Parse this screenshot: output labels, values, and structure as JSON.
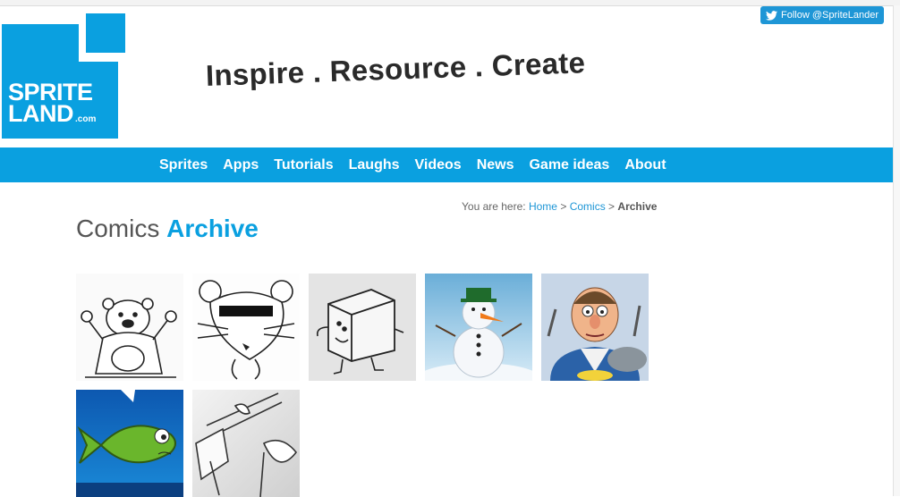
{
  "header": {
    "logo_line1": "SPRITE",
    "logo_line2": "LAND",
    "logo_suffix": ".com",
    "tagline": "Inspire . Resource . Create",
    "follow_button": "Follow @SpriteLander"
  },
  "nav": {
    "items": [
      "Sprites",
      "Apps",
      "Tutorials",
      "Laughs",
      "Videos",
      "News",
      "Game ideas",
      "About"
    ]
  },
  "breadcrumb": {
    "prefix": "You are here:",
    "home": "Home",
    "sep1": ">",
    "comics": "Comics",
    "sep2": ">",
    "current": "Archive"
  },
  "page": {
    "title_part1": "Comics",
    "title_part2": "Archive"
  },
  "comics": [
    {
      "name": "bear-comic"
    },
    {
      "name": "mouse-comic"
    },
    {
      "name": "cube-comic"
    },
    {
      "name": "snowman-comic"
    },
    {
      "name": "chef-comic"
    },
    {
      "name": "fish-comic"
    },
    {
      "name": "sword-comic"
    }
  ],
  "colors": {
    "accent": "#0aa0e0",
    "twitter": "#1e96d6"
  }
}
